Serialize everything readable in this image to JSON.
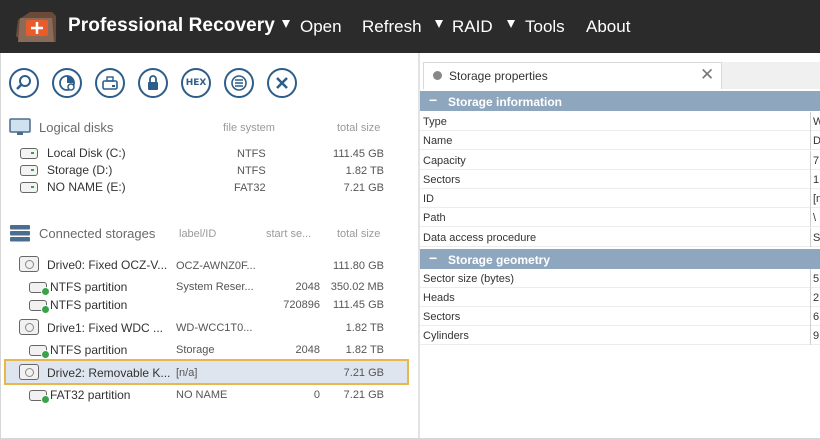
{
  "app": {
    "title": "Professional Recovery",
    "menu": [
      {
        "label": "Open",
        "has_arrow": true
      },
      {
        "label": "Refresh",
        "has_arrow": false
      },
      {
        "label": "RAID",
        "has_arrow": true
      },
      {
        "label": "Tools",
        "has_arrow": true
      },
      {
        "label": "About",
        "has_arrow": false
      }
    ],
    "colors": {
      "titlebar": "#2b2b2b",
      "accent": "#2d5d8a",
      "selection_border": "#e8b64a",
      "group_header": "#8ea7bf"
    }
  },
  "toolbar": {
    "buttons": [
      {
        "icon": "magnifier-icon"
      },
      {
        "icon": "scan-disk-icon"
      },
      {
        "icon": "camera-disk-icon"
      },
      {
        "icon": "lock-icon"
      },
      {
        "icon": "hex-icon",
        "label": "HEX"
      },
      {
        "icon": "list-icon"
      },
      {
        "icon": "close-icon"
      }
    ]
  },
  "logical_disks": {
    "header": "Logical disks",
    "col_fs": "file system",
    "col_size": "total size",
    "rows": [
      {
        "name": "Local Disk (C:)",
        "fs": "NTFS",
        "size": "111.45 GB"
      },
      {
        "name": "Storage (D:)",
        "fs": "NTFS",
        "size": "1.82 TB"
      },
      {
        "name": "NO NAME (E:)",
        "fs": "FAT32",
        "size": "7.21 GB"
      }
    ]
  },
  "connected_storages": {
    "header": "Connected storages",
    "col_label": "label/ID",
    "col_start": "start se...",
    "col_size": "total size",
    "rows": [
      {
        "type": "drive",
        "name": "Drive0: Fixed OCZ-V...",
        "label": "OCZ-AWNZ0F...",
        "start": "",
        "size": "111.80 GB"
      },
      {
        "type": "partition",
        "name": "NTFS partition",
        "label": "System Reser...",
        "start": "2048",
        "size": "350.02 MB"
      },
      {
        "type": "partition",
        "name": "NTFS partition",
        "label": "",
        "start": "720896",
        "size": "111.45 GB"
      },
      {
        "type": "drive",
        "name": "Drive1: Fixed WDC ...",
        "label": "WD-WCC1T0...",
        "start": "",
        "size": "1.82 TB"
      },
      {
        "type": "partition",
        "name": "NTFS partition",
        "label": "Storage",
        "start": "2048",
        "size": "1.82 TB"
      },
      {
        "type": "drive",
        "name": "Drive2: Removable K...",
        "label": "[n/a]",
        "start": "",
        "size": "7.21 GB",
        "selected": true
      },
      {
        "type": "partition",
        "name": "FAT32 partition",
        "label": "NO NAME",
        "start": "0",
        "size": "7.21 GB"
      }
    ]
  },
  "properties_panel": {
    "tab_label": "Storage properties",
    "groups": [
      {
        "title": "Storage information",
        "rows": [
          {
            "key": "Type",
            "value": "W"
          },
          {
            "key": "Name",
            "value": "D"
          },
          {
            "key": "Capacity",
            "value": "7"
          },
          {
            "key": "Sectors",
            "value": "1"
          },
          {
            "key": "ID",
            "value": "[n"
          },
          {
            "key": "Path",
            "value": "\\"
          },
          {
            "key": "Data access procedure",
            "value": "S"
          }
        ]
      },
      {
        "title": "Storage geometry",
        "rows": [
          {
            "key": "Sector size (bytes)",
            "value": "5"
          },
          {
            "key": "Heads",
            "value": "2"
          },
          {
            "key": "Sectors",
            "value": "6"
          },
          {
            "key": "Cylinders",
            "value": "9"
          }
        ]
      }
    ]
  }
}
